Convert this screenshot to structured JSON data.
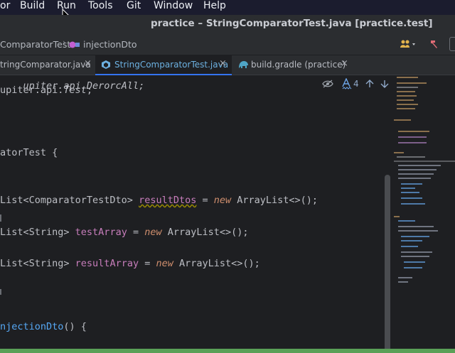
{
  "menubar": {
    "items": [
      "or",
      "Build",
      "Run",
      "Tools",
      "Git",
      "Window",
      "Help"
    ]
  },
  "window": {
    "title": "practice – StringComparatorTest.java [practice.test]"
  },
  "breadcrumbs": [
    "ComparatorTest",
    "injectionDto"
  ],
  "tabs": [
    {
      "label": "tringComparator.java",
      "active": false
    },
    {
      "label": "StringComparatorTest.java",
      "active": true
    },
    {
      "label": "build.gradle (practice)",
      "active": false
    }
  ],
  "editor": {
    "line_imp1": "upiter.api.DerorcAll;",
    "line_imp2_a": "upiter.api.",
    "line_imp2_b": "Test",
    "line_imp2_c": ";",
    "line_class": "atorTest {",
    "line_f1_a": "List<ComparatorTestDto> ",
    "line_f1_b": "resultDtos",
    "line_f1_c": " = ",
    "line_f1_new": "new",
    "line_f1_d": " ArrayList<>();",
    "line_f2_a": "List<String> ",
    "line_f2_b": "testArray",
    "line_f2_c": " = ",
    "line_f2_new": "new",
    "line_f2_d": " ArrayList<>();",
    "line_f3_a": "List<String> ",
    "line_f3_b": "resultArray",
    "line_f3_c": " = ",
    "line_f3_new": "new",
    "line_f3_d": " ArrayList<>();",
    "line_m_a": "njectionDto",
    "line_m_b": "() {",
    "inspection_count": "4"
  },
  "colors": {
    "accent": "#3574f0",
    "field": "#c77dbb",
    "keyword": "#cf8e6d",
    "status_bar": "#5aa057"
  }
}
